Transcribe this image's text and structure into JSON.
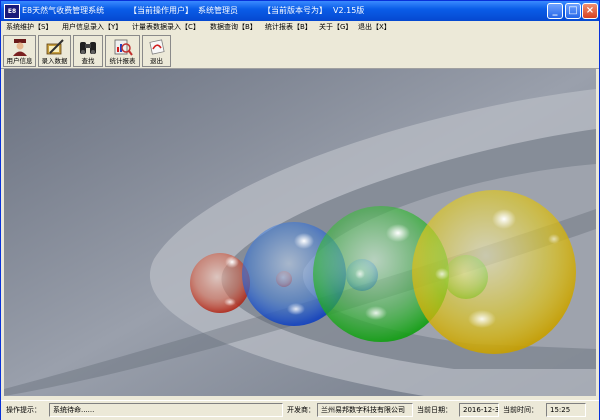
{
  "titlebar": {
    "icon_text": "E8",
    "app_name": "E8天然气收费管理系统",
    "operator_label": "【当前操作用户】",
    "operator": "系统管理员",
    "version_label": "【当前版本号为】",
    "version": "V2.15版",
    "minimize": "_",
    "maximize": "□",
    "close": "×"
  },
  "menu": [
    "系统维护【S】",
    "用户信息录入【Y】",
    "计量表数据录入【C】",
    "数据查询【B】",
    "统计报表【B】",
    "关于【G】",
    "退出【X】"
  ],
  "toolbar": [
    {
      "label": "用户信息",
      "icon": "user-icon"
    },
    {
      "label": "录入数据",
      "icon": "pencil-book-icon"
    },
    {
      "label": "查找",
      "icon": "binoculars-icon"
    },
    {
      "label": "统计报表",
      "icon": "chart-magnifier-icon"
    },
    {
      "label": "退出",
      "icon": "exit-icon"
    }
  ],
  "status": {
    "hint_label": "操作提示：",
    "hint_value": "系统待命......",
    "dev_label": "开发商：",
    "dev_value": "兰州易邦数字科技有限公司",
    "date_label": "当前日期：",
    "date_value": "2016-12-3",
    "time_label": "当前时间：",
    "time_value": "15:25"
  },
  "colors": {
    "titlebar": "#0a5de8",
    "background": "#8890a0",
    "bubble_red": "#e05030",
    "bubble_blue": "#3070e0",
    "bubble_green": "#30c030",
    "bubble_yellow": "#e8c800"
  }
}
